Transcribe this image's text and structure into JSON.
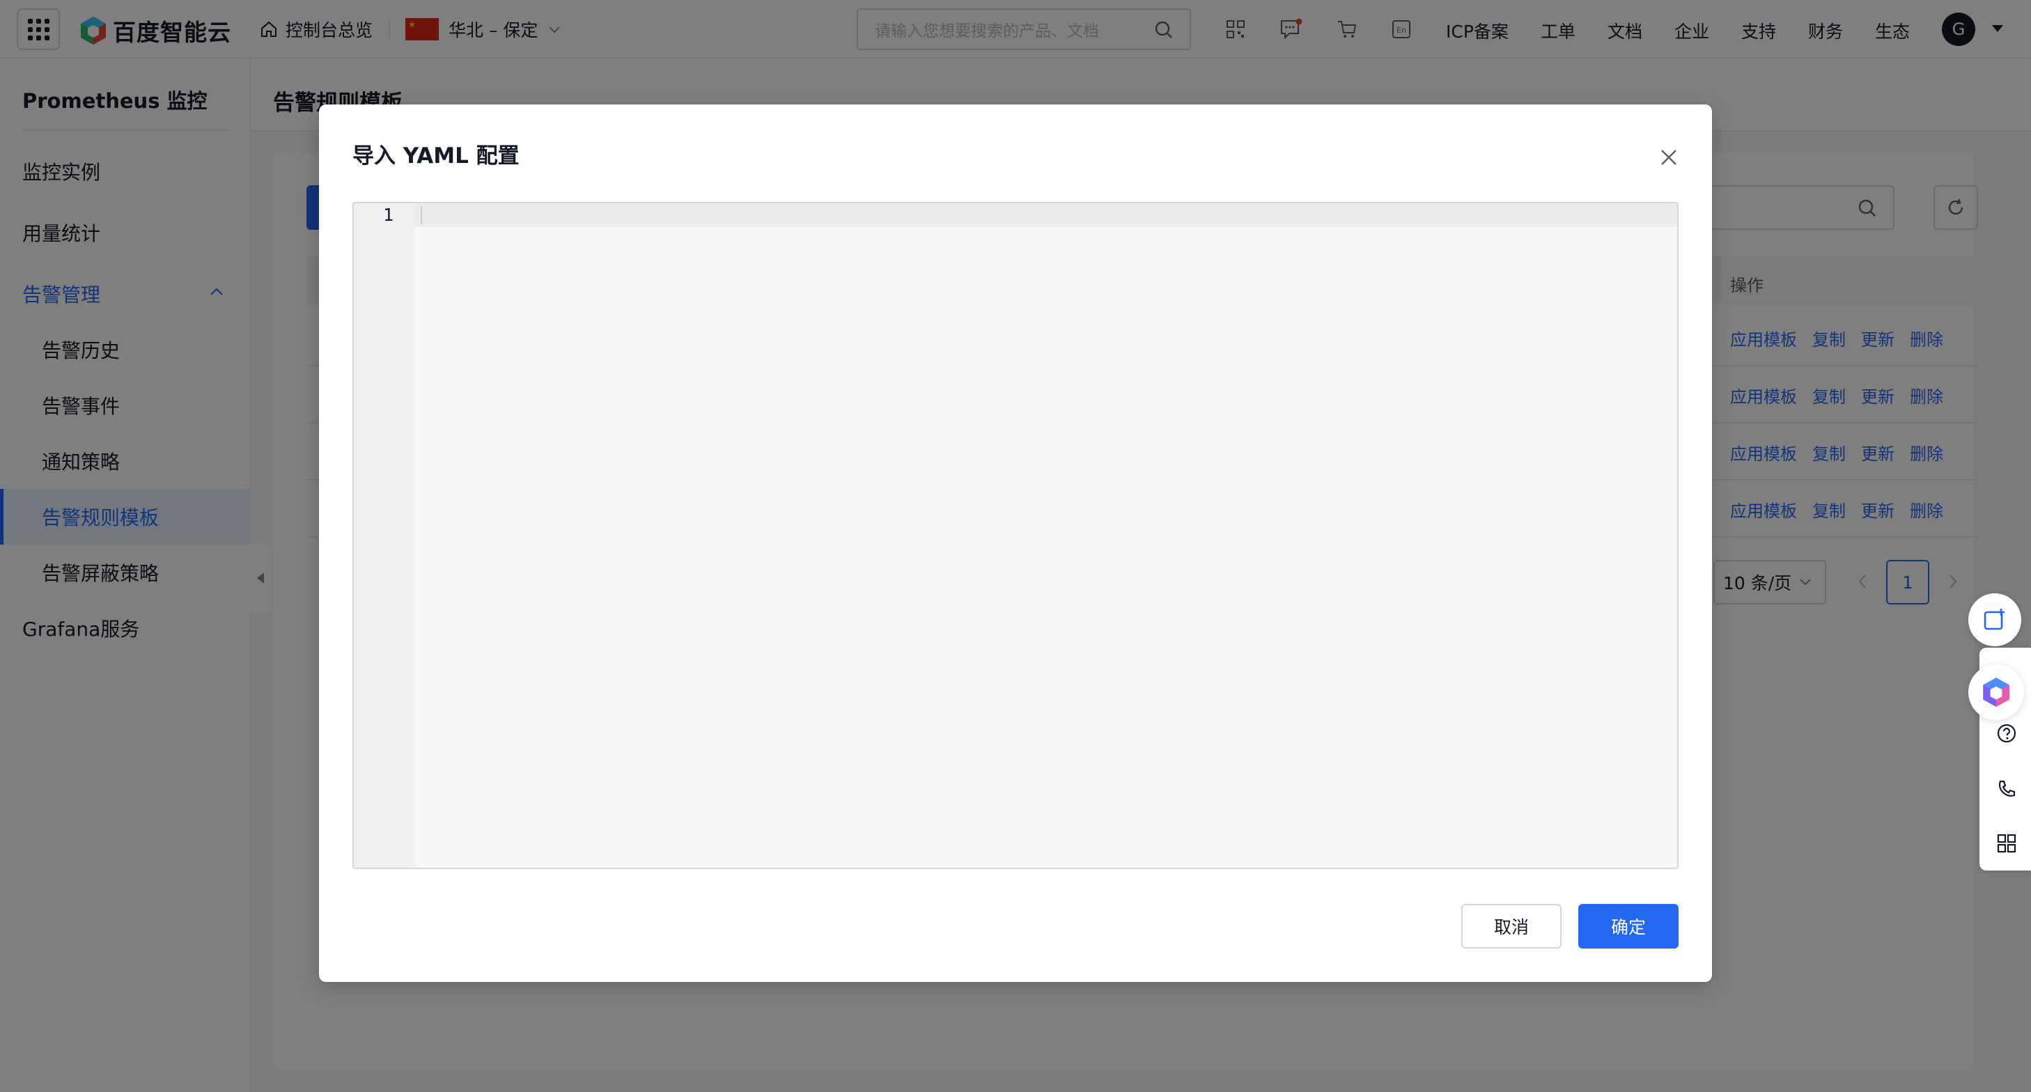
{
  "topbar": {
    "brand": "百度智能云",
    "console_label": "控制台总览",
    "region_label": "华北 – 保定",
    "search_placeholder": "请输入您想要搜索的产品、文档",
    "links": [
      "ICP备案",
      "工单",
      "文档",
      "企业",
      "支持",
      "财务",
      "生态"
    ],
    "avatar_initial": "G"
  },
  "sidebar": {
    "title": "Prometheus 监控",
    "items": [
      {
        "label": "监控实例"
      },
      {
        "label": "用量统计"
      },
      {
        "label": "告警管理"
      },
      {
        "label": "告警历史"
      },
      {
        "label": "告警事件"
      },
      {
        "label": "通知策略"
      },
      {
        "label": "告警规则模板"
      },
      {
        "label": "告警屏蔽策略"
      },
      {
        "label": "Grafana服务"
      }
    ]
  },
  "page": {
    "title": "告警规则模板",
    "ops_header": "操作",
    "row_actions": [
      "应用模板",
      "复制",
      "更新",
      "删除"
    ],
    "page_size": "10 条/页",
    "current_page": "1"
  },
  "modal": {
    "title": "导入 YAML 配置",
    "editor_line_number": "1",
    "editor_content": "",
    "cancel_label": "取消",
    "confirm_label": "确定"
  },
  "colors": {
    "accent": "#2468f2",
    "mask": "rgba(0,0,0,0.5)"
  }
}
